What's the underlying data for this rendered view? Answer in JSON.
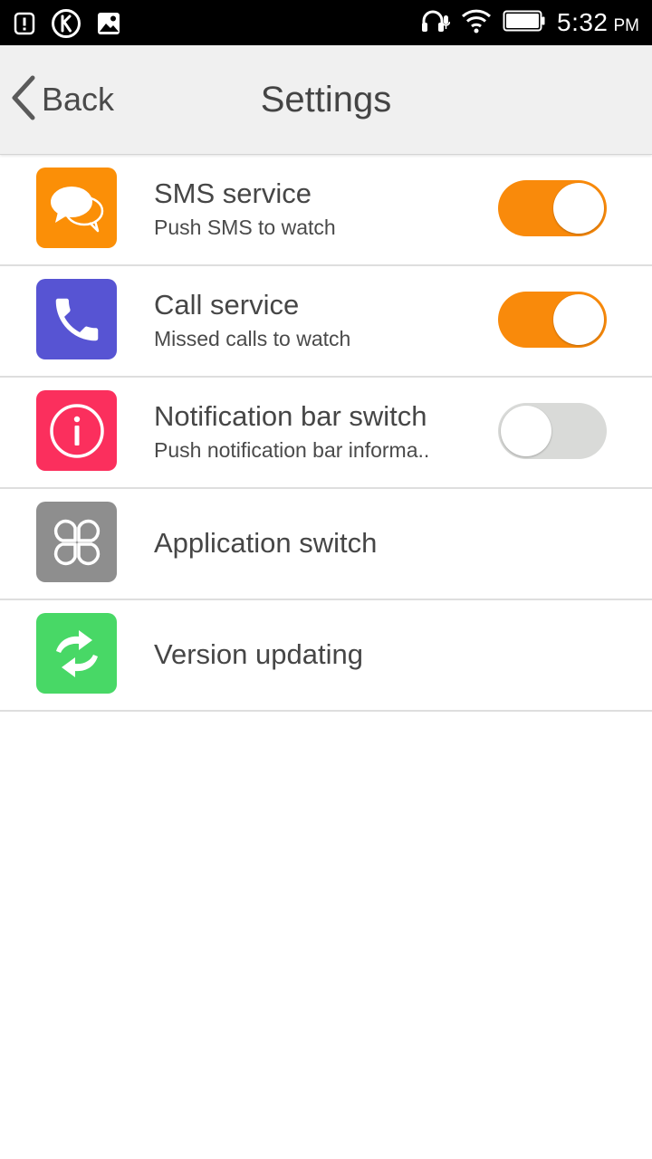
{
  "status_bar": {
    "time": "5:32",
    "ampm": "PM",
    "icons": [
      "alert-icon",
      "k-app-icon",
      "gallery-icon",
      "headset-mic-icon",
      "wifi-icon",
      "battery-icon"
    ]
  },
  "header": {
    "back_label": "Back",
    "title": "Settings"
  },
  "colors": {
    "toggle_on": "#f98a0b",
    "toggle_off": "#d9dad8",
    "sms_icon_bg": "#fb8f07",
    "call_icon_bg": "#5754d3",
    "notification_icon_bg": "#fb2f5d",
    "application_icon_bg": "#8e8e8e",
    "version_icon_bg": "#48d866"
  },
  "settings": [
    {
      "title": "SMS service",
      "subtitle": "Push SMS to watch",
      "icon": "chat-bubbles-icon",
      "toggle": true,
      "toggle_state": "on"
    },
    {
      "title": "Call service",
      "subtitle": "Missed calls to watch",
      "icon": "phone-icon",
      "toggle": true,
      "toggle_state": "on"
    },
    {
      "title": "Notification bar switch",
      "subtitle": "Push notification bar informa..",
      "icon": "info-icon",
      "toggle": true,
      "toggle_state": "off"
    },
    {
      "title": "Application switch",
      "icon": "apps-clover-icon",
      "toggle": false
    },
    {
      "title": "Version updating",
      "icon": "sync-arrows-icon",
      "toggle": false
    }
  ]
}
